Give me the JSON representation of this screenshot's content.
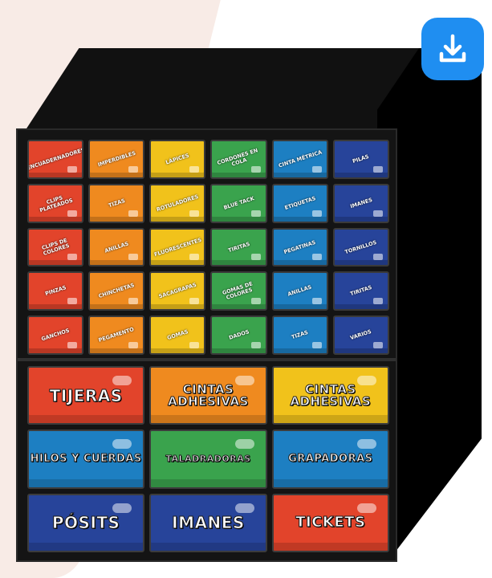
{
  "download_button": {
    "icon": "download-icon",
    "color": "#1f8ef1"
  },
  "small_drawers": [
    {
      "label": "ENCUADERNADORES",
      "color": "#e2442b"
    },
    {
      "label": "IMPERDIBLES",
      "color": "#ef8a1f"
    },
    {
      "label": "LÁPICES",
      "color": "#f1c21b"
    },
    {
      "label": "CORDONES EN COLA",
      "color": "#3aa34d"
    },
    {
      "label": "CINTA MÉTRICA",
      "color": "#1d7fc2"
    },
    {
      "label": "PILAS",
      "color": "#27449a"
    },
    {
      "label": "CLIPS PLATEADOS",
      "color": "#e2442b"
    },
    {
      "label": "TIZAS",
      "color": "#ef8a1f"
    },
    {
      "label": "ROTULADORES",
      "color": "#f1c21b"
    },
    {
      "label": "BLUE TACK",
      "color": "#3aa34d"
    },
    {
      "label": "ETIQUETAS",
      "color": "#1d7fc2"
    },
    {
      "label": "IMANES",
      "color": "#27449a"
    },
    {
      "label": "CLIPS DE COLORES",
      "color": "#e2442b"
    },
    {
      "label": "ANILLAS",
      "color": "#ef8a1f"
    },
    {
      "label": "FLUORESCENTES",
      "color": "#f1c21b"
    },
    {
      "label": "TIRITAS",
      "color": "#3aa34d"
    },
    {
      "label": "PEGATINAS",
      "color": "#1d7fc2"
    },
    {
      "label": "TORNILLOS",
      "color": "#27449a"
    },
    {
      "label": "PINZAS",
      "color": "#e2442b"
    },
    {
      "label": "CHINCHETAS",
      "color": "#ef8a1f"
    },
    {
      "label": "SACAGRAPAS",
      "color": "#f1c21b"
    },
    {
      "label": "GOMAS DE COLORES",
      "color": "#3aa34d"
    },
    {
      "label": "ANILLAS",
      "color": "#1d7fc2"
    },
    {
      "label": "TIRITAS",
      "color": "#27449a"
    },
    {
      "label": "GANCHOS",
      "color": "#e2442b"
    },
    {
      "label": "PEGAMENTO",
      "color": "#ef8a1f"
    },
    {
      "label": "GOMAS",
      "color": "#f1c21b"
    },
    {
      "label": "DADOS",
      "color": "#3aa34d"
    },
    {
      "label": "TIZAS",
      "color": "#1d7fc2"
    },
    {
      "label": "VARIOS",
      "color": "#27449a"
    }
  ],
  "big_drawers": [
    {
      "label": "TIJERAS",
      "color": "#e2442b",
      "size": 20
    },
    {
      "label": "CINTAS ADHESIVAS",
      "color": "#ef8a1f",
      "size": 15
    },
    {
      "label": "CINTAS ADHESIVAS",
      "color": "#f1c21b",
      "size": 15
    },
    {
      "label": "HILOS Y CUERDAS",
      "color": "#1d7fc2",
      "size": 13
    },
    {
      "label": "TALADRADORAS",
      "color": "#3aa34d",
      "size": 11
    },
    {
      "label": "GRAPADORAS",
      "color": "#1d7fc2",
      "size": 13
    },
    {
      "label": "PÓSITS",
      "color": "#27449a",
      "size": 20
    },
    {
      "label": "IMANES",
      "color": "#27449a",
      "size": 20
    },
    {
      "label": "TICKETS",
      "color": "#e2442b",
      "size": 18
    }
  ]
}
